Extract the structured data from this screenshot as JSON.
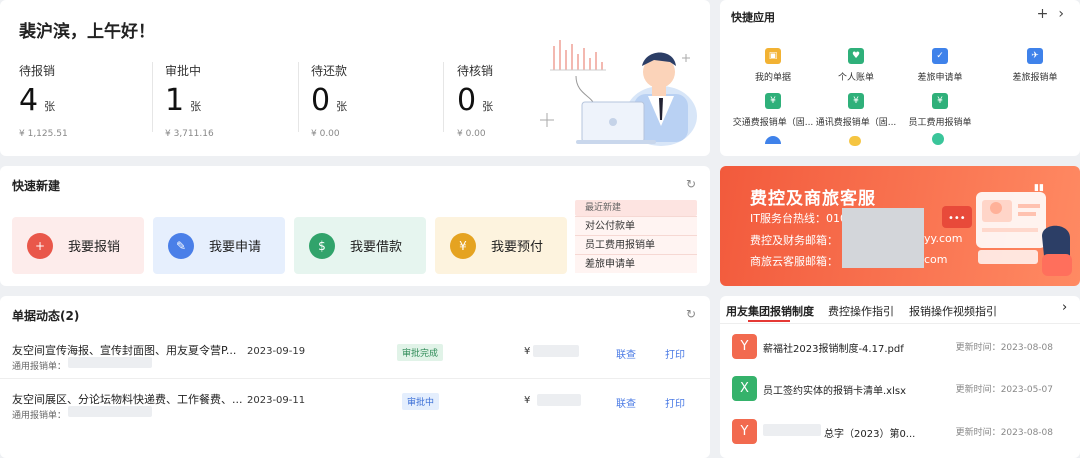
{
  "greeting": "裴沪滨，上午好！",
  "stats": [
    {
      "label": "待报销",
      "count": "4",
      "unit": "张",
      "amount": "¥ 1,125.51"
    },
    {
      "label": "审批中",
      "count": "1",
      "unit": "张",
      "amount": "¥ 3,711.16"
    },
    {
      "label": "待还款",
      "count": "0",
      "unit": "张",
      "amount": "¥ 0.00"
    },
    {
      "label": "待核销",
      "count": "0",
      "unit": "张",
      "amount": "¥ 0.00"
    }
  ],
  "quick_create": {
    "title": "快速新建",
    "buttons": [
      {
        "label": "我要报销",
        "color": "#fdeceb",
        "icon_color": "#e9574a"
      },
      {
        "label": "我要申请",
        "color": "#e6effd",
        "icon_color": "#4a7fe8"
      },
      {
        "label": "我要借款",
        "color": "#e6f5ef",
        "icon_color": "#31a36b"
      },
      {
        "label": "我要预付",
        "color": "#fdf3de",
        "icon_color": "#e5a321"
      }
    ],
    "recent_title": "最近新建",
    "recent": [
      "对公付款单",
      "员工费用报销单",
      "差旅申请单"
    ]
  },
  "dynamics": {
    "title": "单据动态(2)",
    "rows": [
      {
        "title": "友空间宣传海报、宣传封面图、用友夏令营P...",
        "sub": "通用报销单：",
        "date": "2023-09-19",
        "status": "审批完成",
        "yen": "¥",
        "link1": "联查",
        "link2": "打印"
      },
      {
        "title": "友空间展区、分论坛物料快递费、工作餐费、...",
        "sub": "通用报销单：",
        "date": "2023-09-11",
        "status": "审批中",
        "yen": "¥",
        "link1": "联查",
        "link2": "打印"
      }
    ]
  },
  "apps": {
    "title": "快捷应用",
    "add_icon": "+",
    "next_icon": "›",
    "items": [
      {
        "label": "我的单据",
        "color": "#f2b233"
      },
      {
        "label": "个人账单",
        "color": "#2fb07a"
      },
      {
        "label": "差旅申请单",
        "color": "#3f82ea"
      },
      {
        "label": "差旅报销单",
        "color": "#3f82ea"
      },
      {
        "label": "交通费报销单（固...",
        "color": "#2fb07a"
      },
      {
        "label": "通讯费报销单（固...",
        "color": "#2fb07a"
      },
      {
        "label": "员工费用报销单",
        "color": "#2fb07a"
      }
    ]
  },
  "banner": {
    "title": "费控及商旅客服",
    "lines": [
      "IT服务台热线：010",
      "费控及财务邮箱：",
      "商旅云客服邮箱："
    ],
    "tail1": "yy.com",
    "tail2": "com"
  },
  "docs": {
    "tabs": [
      "用友集团报销制度",
      "费控操作指引",
      "报销操作视频指引"
    ],
    "more_icon": "›",
    "update_label": "更新时间：",
    "items": [
      {
        "name": "薪福社2023报销制度-4.17.pdf",
        "time": "2023-08-08",
        "color": "#f26a4f",
        "glyph": "Y"
      },
      {
        "name": "员工签约实体的报销卡清单.xlsx",
        "time": "2023-05-07",
        "color": "#35b26b",
        "glyph": "X"
      },
      {
        "name": "总字（2023）第0...",
        "time": "2023-08-08",
        "color": "#f26a4f",
        "glyph": "Y"
      }
    ]
  }
}
